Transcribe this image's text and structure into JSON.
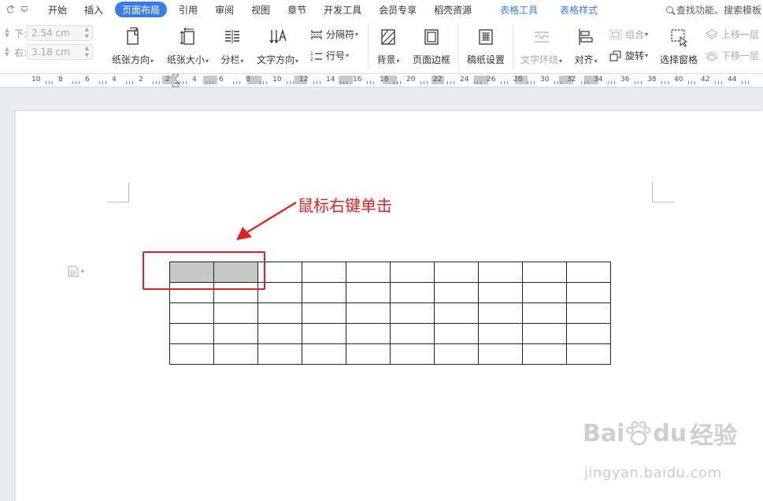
{
  "menu": {
    "items": [
      {
        "label": "开始"
      },
      {
        "label": "插入"
      },
      {
        "label": "页面布局",
        "active": true
      },
      {
        "label": "引用"
      },
      {
        "label": "审阅"
      },
      {
        "label": "视图"
      },
      {
        "label": "章节"
      },
      {
        "label": "开发工具"
      },
      {
        "label": "会员专享"
      },
      {
        "label": "稻壳资源"
      }
    ],
    "context_tabs": [
      "表格工具",
      "表格样式"
    ],
    "search": "查找功能、搜索模板"
  },
  "ribbon": {
    "margin_bottom_label": "下:",
    "margin_bottom_value": "2.54 cm",
    "margin_right_label": "右:",
    "margin_right_value": "3.18 cm",
    "orientation": "纸张方向",
    "size": "纸张大小",
    "columns": "分栏",
    "text_direction": "文字方向",
    "breaks": "分隔符",
    "line_numbers": "行号",
    "background": "背景",
    "page_border": "页面边框",
    "manuscript": "稿纸设置",
    "text_wrap": "文字环绕",
    "align": "对齐",
    "rotate": "旋转",
    "selection_pane": "选择窗格",
    "group": "组合",
    "bring_forward": "上移一层",
    "send_backward": "下移一层"
  },
  "ruler": {
    "labels": [
      "10",
      "8",
      "6",
      "4",
      "2",
      "2",
      "4",
      "6",
      "8",
      "10",
      "12",
      "14",
      "16",
      "18",
      "20",
      "22",
      "24",
      "26",
      "28",
      "30",
      "32",
      "34",
      "36",
      "38",
      "40",
      "42",
      "44"
    ]
  },
  "document": {
    "annotation": "鼠标右键单击",
    "table_rows": 5,
    "table_cols": 10,
    "selected_cells": [
      [
        0,
        0
      ],
      [
        0,
        1
      ]
    ]
  },
  "watermark": {
    "brand": "Bai",
    "brand_suffix": "du",
    "brand_cn": "经验",
    "url": "jingyan.baidu.com"
  },
  "colors": {
    "accent": "#3b7de8",
    "annotation": "#e02020",
    "selection": "#c8c8c8"
  }
}
